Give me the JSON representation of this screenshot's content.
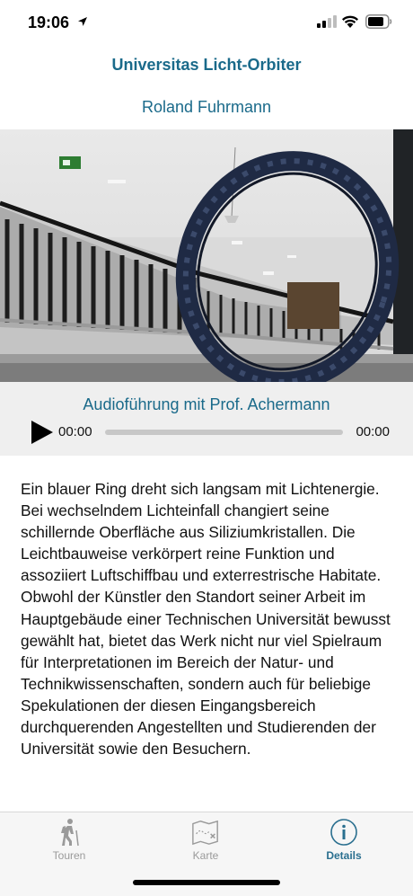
{
  "status": {
    "time": "19:06"
  },
  "header": {
    "title": "Universitas Licht-Orbiter",
    "artist": "Roland Fuhrmann"
  },
  "photo": {
    "exit_sign_color": "#2e7d32",
    "ring_color": "#1f2a44"
  },
  "audio": {
    "title": "Audioführung mit Prof. Achermann",
    "current_time": "00:00",
    "duration": "00:00",
    "progress": 0
  },
  "description": "Ein blauer Ring dreht sich langsam mit Lichtenergie. Bei wechselndem Lichteinfall changiert seine schillernde Oberfläche aus Siliziumkristallen. Die Leichtbauweise verkörpert reine Funktion und assoziiert Luftschiffbau und exterrestrische Habitate. Obwohl der Künstler den Standort seiner Arbeit im Hauptgebäude einer Technischen Universität bewusst gewählt hat, bietet das Werk nicht nur viel Spielraum für Interpretationen im Bereich der Natur- und Technikwissenschaften, sondern auch für beliebige Spekulationen der diesen Eingangsbereich durchquerenden Angestellten und Studierenden der Universität sowie den Besuchern.",
  "tabs": [
    {
      "label": "Touren",
      "icon": "hiker-icon",
      "active": false
    },
    {
      "label": "Karte",
      "icon": "map-icon",
      "active": false
    },
    {
      "label": "Details",
      "icon": "info-icon",
      "active": true
    }
  ],
  "colors": {
    "accent": "#1a6a8a",
    "tab_active": "#2a6f8f",
    "tab_inactive": "#9a9a9a"
  }
}
